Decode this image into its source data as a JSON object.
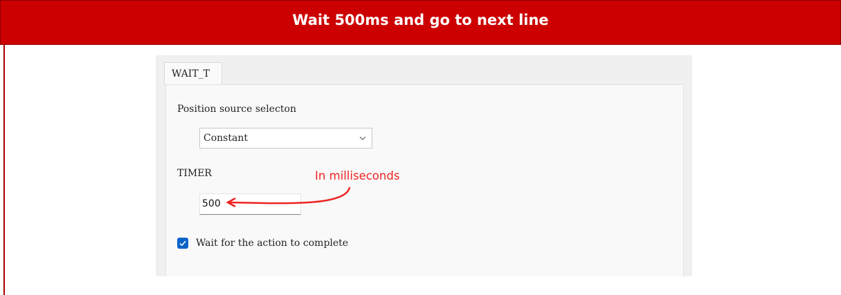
{
  "banner": {
    "title": "Wait 500ms and go to next line"
  },
  "dialog": {
    "tab": "WAIT_T",
    "position_source": {
      "label": "Position source selecton",
      "selected": "Constant"
    },
    "timer": {
      "label": "TIMER",
      "value": "500"
    },
    "wait_checkbox": {
      "label": "Wait for the action to complete",
      "checked": true
    }
  },
  "annotation": {
    "text": "In milliseconds",
    "color": "#ee2222"
  },
  "colors": {
    "banner": "#cc0000",
    "checkbox": "#0a64c8"
  }
}
